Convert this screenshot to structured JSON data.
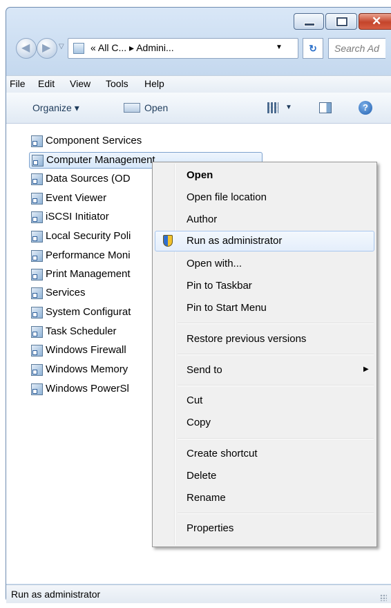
{
  "window": {
    "address": {
      "root_glyph": "«",
      "crumb1": "All C...",
      "separator": "▸",
      "crumb2": "Admini...",
      "dropdown": "▼"
    },
    "search_placeholder": "Search Ad",
    "caption": {
      "close_glyph": "✕"
    }
  },
  "menubar": {
    "items": [
      "File",
      "Edit",
      "View",
      "Tools",
      "Help"
    ]
  },
  "toolbar": {
    "organize": "Organize ▾",
    "open": "Open",
    "view_arrow": "▼",
    "help": "?"
  },
  "files": [
    {
      "label": "Component Services"
    },
    {
      "label": "Computer Management"
    },
    {
      "label": "Data Sources (OD"
    },
    {
      "label": "Event Viewer"
    },
    {
      "label": "iSCSI Initiator"
    },
    {
      "label": "Local Security Poli"
    },
    {
      "label": "Performance Moni"
    },
    {
      "label": "Print Management"
    },
    {
      "label": "Services"
    },
    {
      "label": "System Configurat"
    },
    {
      "label": "Task Scheduler"
    },
    {
      "label": "Windows Firewall"
    },
    {
      "label": "Windows Memory"
    },
    {
      "label": "Windows PowerSl"
    }
  ],
  "context_menu": {
    "items": [
      {
        "label": "Open",
        "bold": true
      },
      {
        "label": "Open file location"
      },
      {
        "label": "Author"
      },
      {
        "label": "Run as administrator",
        "highlighted": true,
        "icon": "uac-shield-icon"
      },
      {
        "label": "Open with..."
      },
      {
        "label": "Pin to Taskbar"
      },
      {
        "label": "Pin to Start Menu"
      },
      {
        "label": "Restore previous versions"
      },
      {
        "label": "Send to",
        "submenu": true
      },
      {
        "label": "Cut"
      },
      {
        "label": "Copy"
      },
      {
        "label": "Create shortcut"
      },
      {
        "label": "Delete"
      },
      {
        "label": "Rename"
      },
      {
        "label": "Properties"
      }
    ],
    "submenu_arrow": "▶"
  },
  "statusbar": {
    "text": "Run as administrator"
  }
}
